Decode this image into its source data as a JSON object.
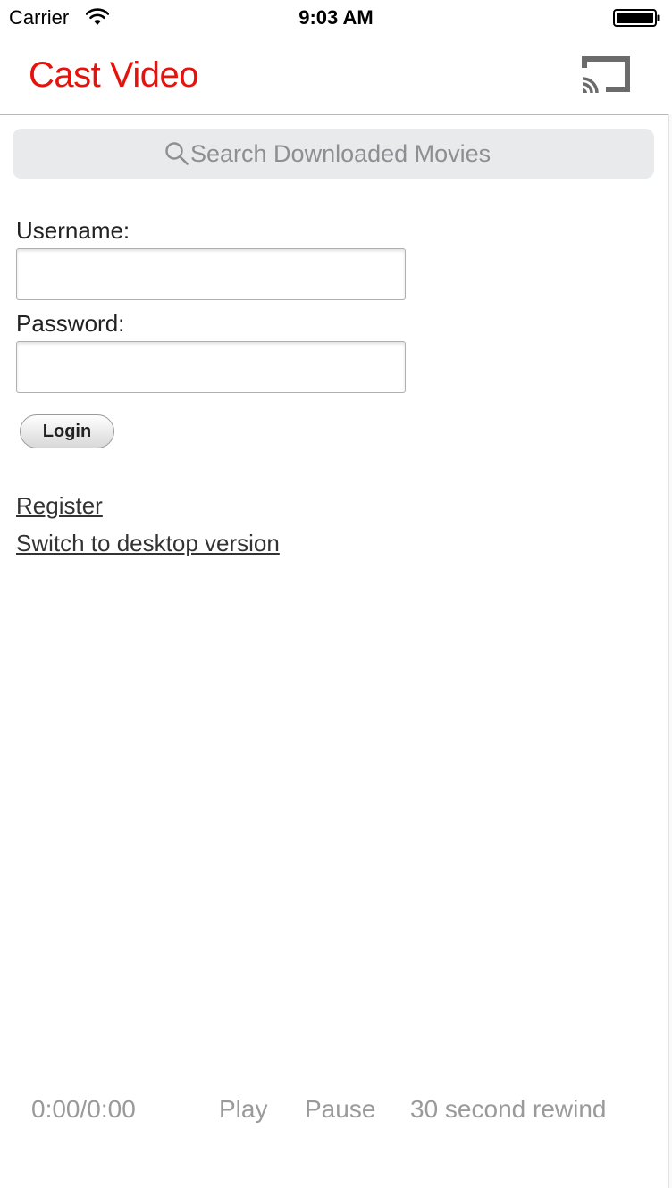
{
  "status_bar": {
    "carrier": "Carrier",
    "time": "9:03 AM",
    "wifi_icon": "wifi-icon",
    "battery_icon": "battery-full-icon"
  },
  "nav": {
    "title": "Cast Video",
    "title_color": "#e8120c",
    "cast_icon": "chromecast-icon"
  },
  "search": {
    "placeholder": "Search Downloaded Movies",
    "icon": "search-icon"
  },
  "login_form": {
    "username_label": "Username:",
    "username_value": "",
    "password_label": "Password:",
    "password_value": "",
    "login_button": "Login"
  },
  "links": {
    "register": "Register",
    "desktop": "Switch to desktop version"
  },
  "player": {
    "time": "0:00/0:00",
    "play": "Play",
    "pause": "Pause",
    "rewind": "30 second rewind"
  }
}
